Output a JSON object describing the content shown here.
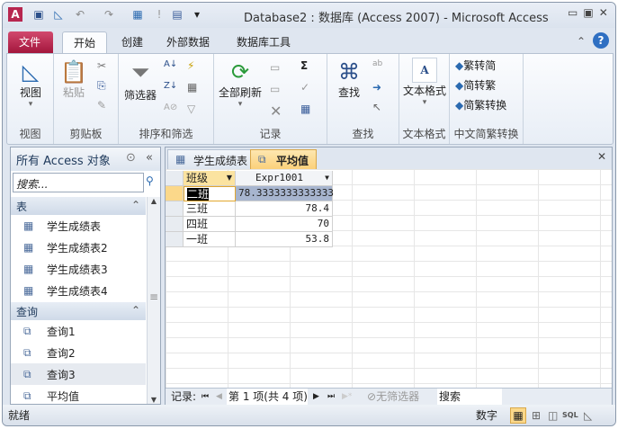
{
  "title": "Database2 : 数据库 (Access 2007)  -  Microsoft Access",
  "quick_access": {
    "app_icon": "A",
    "save": "save-icon",
    "design": "design-view-icon",
    "undo": "undo-icon",
    "redo": "redo-icon",
    "run": "!",
    "customize": "▾"
  },
  "tabs": [
    "文件",
    "开始",
    "创建",
    "外部数据",
    "数据库工具"
  ],
  "ribbon": {
    "groups": [
      {
        "label": "视图",
        "buttons": [
          "视图"
        ]
      },
      {
        "label": "剪贴板",
        "buttons": [
          "粘贴"
        ]
      },
      {
        "label": "排序和筛选",
        "buttons": [
          "筛选器"
        ]
      },
      {
        "label": "记录",
        "buttons": [
          "全部刷新"
        ]
      },
      {
        "label": "查找",
        "buttons": [
          "查找"
        ]
      },
      {
        "label": "文本格式",
        "buttons": [
          "文本格式"
        ]
      },
      {
        "label": "中文简繁转换",
        "buttons": [
          "繁转简",
          "简转繁",
          "简繁转换"
        ]
      }
    ]
  },
  "nav": {
    "header": "所有 Access 对象",
    "search_placeholder": "搜索...",
    "sections": [
      {
        "label": "表",
        "items": [
          "学生成绩表",
          "学生成绩表2",
          "学生成绩表3",
          "学生成绩表4"
        ]
      },
      {
        "label": "查询",
        "items": [
          "查询1",
          "查询2",
          "查询3",
          "平均值"
        ]
      }
    ]
  },
  "doc_tabs": [
    "学生成绩表",
    "平均值"
  ],
  "datasheet": {
    "columns": [
      "班级",
      "Expr1001"
    ],
    "rows": [
      [
        "二班",
        "78.3333333333333"
      ],
      [
        "三班",
        "78.4"
      ],
      [
        "四班",
        "70"
      ],
      [
        "一班",
        "53.8"
      ]
    ]
  },
  "record_nav": {
    "label": "记录:",
    "position": "第 1 项(共 4 项)",
    "filter": "无筛选器",
    "search": "搜索"
  },
  "status": {
    "left": "就绪",
    "num": "数字",
    "views": [
      "datasheet",
      "pivot-table",
      "pivot-chart",
      "SQL",
      "design"
    ]
  },
  "colors": {
    "file_tab": "#b7264f",
    "active_doc_tab": "#fbd88a",
    "selected_row": "#fbe3a0",
    "selected_cell": "#a7b5cf"
  }
}
